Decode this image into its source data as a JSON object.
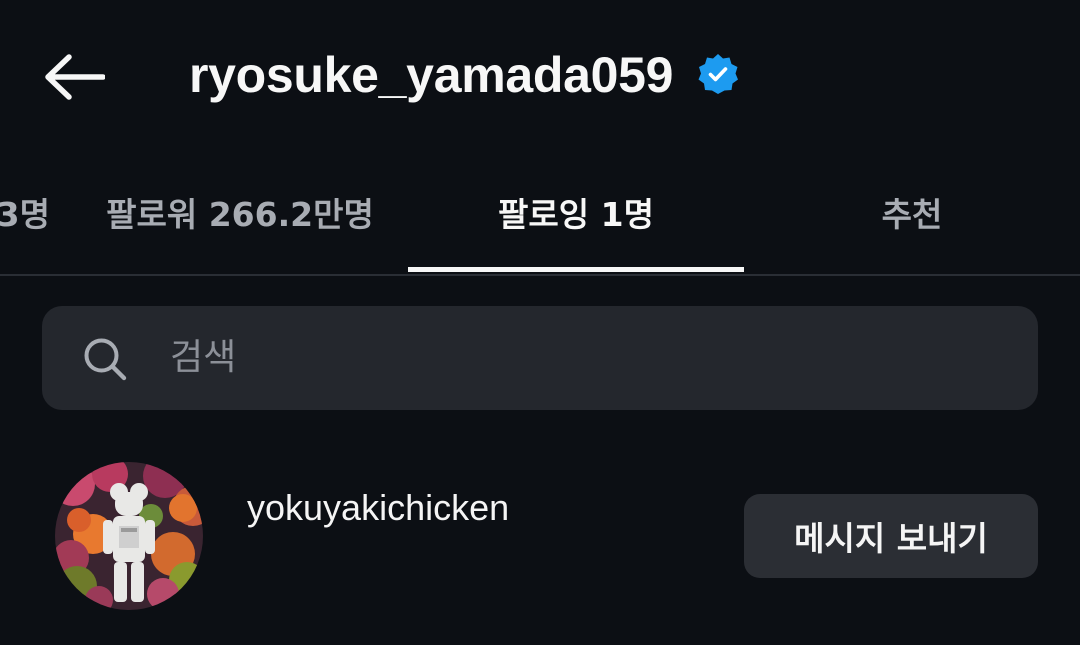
{
  "header": {
    "back_icon": "arrow-left-icon",
    "title": "ryosuke_yamada059",
    "verified_icon": "verified-badge-icon",
    "verified_color": "#1d9bf0"
  },
  "tabs": [
    {
      "label": "3명"
    },
    {
      "label": "팔로워 266.2만명"
    },
    {
      "label": "팔로잉 1명",
      "active": true
    },
    {
      "label": "추천"
    }
  ],
  "search": {
    "icon": "search-icon",
    "placeholder": "검색"
  },
  "following_list": [
    {
      "username": "yokuyakichicken",
      "avatar_icon": "avatar",
      "action_label": "메시지 보내기"
    }
  ]
}
